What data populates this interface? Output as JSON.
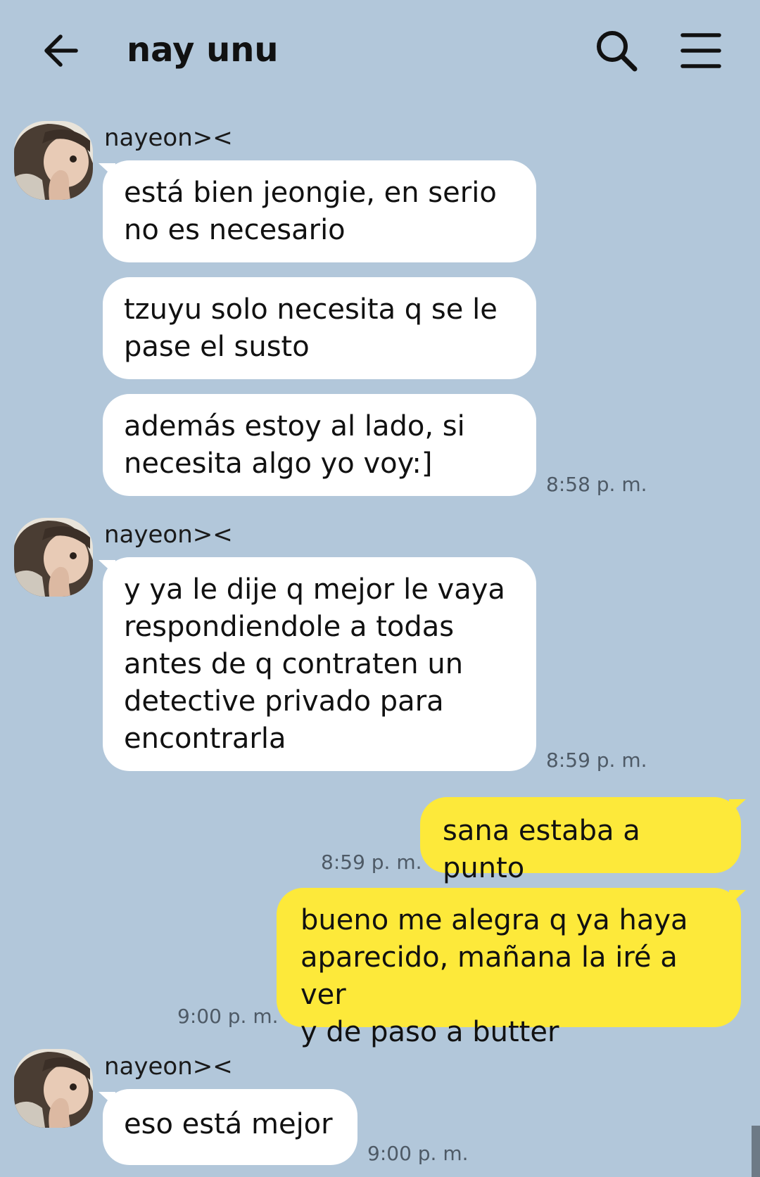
{
  "header": {
    "title": "nay unu",
    "back_icon": "arrow-left-icon",
    "search_icon": "search-icon",
    "menu_icon": "hamburger-menu-icon"
  },
  "colors": {
    "background": "#b2c7da",
    "incoming_bubble": "#ffffff",
    "outgoing_bubble": "#fde93a"
  },
  "messages": [
    {
      "sender": "nayeon><",
      "direction": "incoming",
      "bubbles": [
        "está bien jeongie, en serio\nno es necesario",
        "tzuyu solo necesita q se le\npase el susto",
        "además estoy al lado, si\nnecesita algo yo voy:]"
      ],
      "time": "8:58 p. m."
    },
    {
      "sender": "nayeon><",
      "direction": "incoming",
      "bubbles": [
        "y ya le dije q mejor le vaya\nrespondiendole a todas\nantes de q contraten un\ndetective privado para\nencontrarla"
      ],
      "time": "8:59 p. m."
    },
    {
      "direction": "outgoing",
      "bubbles": [
        "sana estaba a punto"
      ],
      "time": "8:59 p. m."
    },
    {
      "direction": "outgoing",
      "bubbles": [
        "bueno me alegra q ya haya\naparecido, mañana la iré a ver\ny de paso a butter"
      ],
      "time": "9:00 p. m."
    },
    {
      "sender": "nayeon><",
      "direction": "incoming",
      "bubbles": [
        "eso está mejor"
      ],
      "time": "9:00 p. m."
    }
  ]
}
